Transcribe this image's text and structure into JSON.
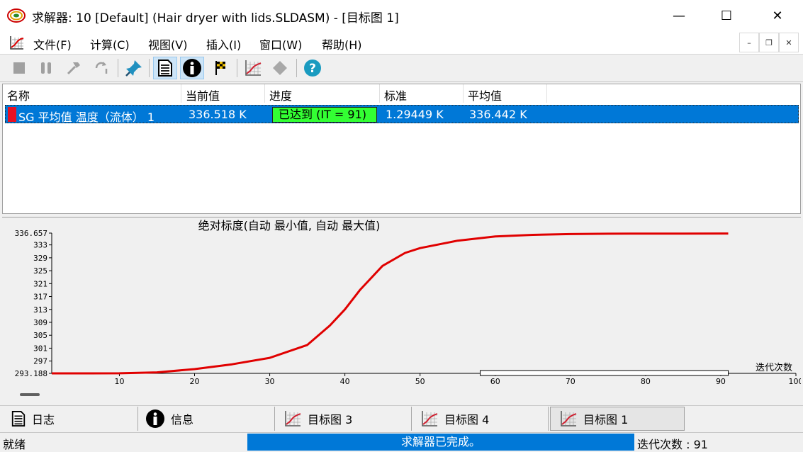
{
  "window": {
    "title": "求解器: 10 [Default] (Hair dryer with lids.SLDASM) - [目标图 1]",
    "minimize": "—",
    "maximize": "☐",
    "close": "✕"
  },
  "menu": [
    "文件(F)",
    "计算(C)",
    "视图(V)",
    "插入(I)",
    "窗口(W)",
    "帮助(H)"
  ],
  "mdi_buttons": [
    "–",
    "❐",
    "✕"
  ],
  "toolbar": {
    "buttons": [
      "stop-icon",
      "pause-icon",
      "hammer-icon",
      "refresh-icon",
      "pin-icon",
      "document-icon",
      "info-icon",
      "flag-icon",
      "chart-icon",
      "diamond-icon",
      "help-icon"
    ]
  },
  "table": {
    "headers": [
      "名称",
      "当前值",
      "进度",
      "标准",
      "平均值"
    ],
    "rows": [
      {
        "name": "SG 平均值 温度（流体） 1",
        "current": "336.518 K",
        "progress": "已达到 (IT = 91)",
        "criterion": "1.29449 K",
        "average": "336.442 K"
      }
    ]
  },
  "chart_data": {
    "type": "line",
    "title": "绝对标度(自动  最小值, 自动  最大值)",
    "xlabel": "迭代次数",
    "ylabel": "",
    "xlim": [
      1,
      100
    ],
    "ylim": [
      293.188,
      336.657
    ],
    "yticks": [
      "336.657",
      "333",
      "329",
      "325",
      "321",
      "317",
      "313",
      "309",
      "305",
      "301",
      "297",
      "293.188"
    ],
    "ytick_values": [
      336.657,
      333,
      329,
      325,
      321,
      317,
      313,
      309,
      305,
      301,
      297,
      293.188
    ],
    "xticks": [
      10,
      20,
      30,
      40,
      50,
      60,
      70,
      80,
      90,
      100
    ],
    "series": [
      {
        "color": "#e00000",
        "x": [
          1,
          5,
          10,
          15,
          20,
          25,
          30,
          35,
          38,
          40,
          42,
          45,
          48,
          50,
          55,
          60,
          65,
          70,
          75,
          80,
          85,
          91
        ],
        "y": [
          293.188,
          293.19,
          293.2,
          293.5,
          294.5,
          296,
          298,
          302,
          308,
          313,
          319,
          326.5,
          330.5,
          332,
          334.3,
          335.6,
          336.1,
          336.35,
          336.45,
          336.5,
          336.51,
          336.518
        ]
      }
    ],
    "iteration_window": [
      58,
      91
    ]
  },
  "tabs": [
    {
      "label": "日志",
      "icon": "document-icon"
    },
    {
      "label": "信息",
      "icon": "info-icon"
    },
    {
      "label": "目标图 3",
      "icon": "chart-icon"
    },
    {
      "label": "目标图 4",
      "icon": "chart-icon"
    },
    {
      "label": "目标图 1",
      "icon": "chart-icon"
    }
  ],
  "status": {
    "left": "就绪",
    "center": "求解器已完成。",
    "right": "迭代次数 : 91"
  }
}
